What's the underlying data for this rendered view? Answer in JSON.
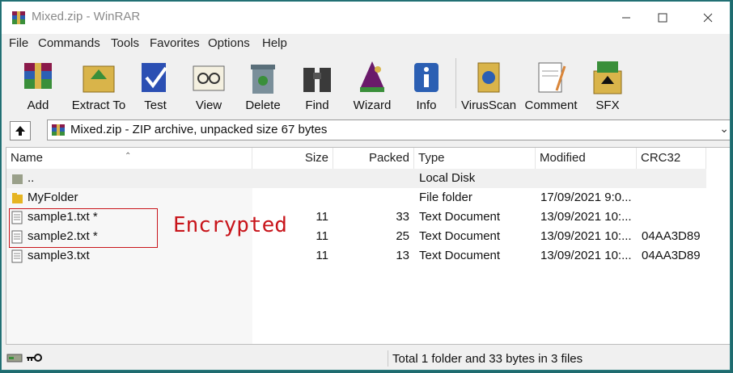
{
  "window": {
    "title": "Mixed.zip - WinRAR"
  },
  "menu": [
    "File",
    "Commands",
    "Tools",
    "Favorites",
    "Options",
    "Help"
  ],
  "toolbar": [
    {
      "label": "Add",
      "icon": "add-icon"
    },
    {
      "label": "Extract To",
      "icon": "extract-to-icon"
    },
    {
      "label": "Test",
      "icon": "test-icon"
    },
    {
      "label": "View",
      "icon": "view-icon"
    },
    {
      "label": "Delete",
      "icon": "delete-icon"
    },
    {
      "label": "Find",
      "icon": "find-icon"
    },
    {
      "label": "Wizard",
      "icon": "wizard-icon"
    },
    {
      "label": "Info",
      "icon": "info-icon"
    },
    {
      "label": "VirusScan",
      "icon": "virusscan-icon"
    },
    {
      "label": "Comment",
      "icon": "comment-icon"
    },
    {
      "label": "SFX",
      "icon": "sfx-icon"
    }
  ],
  "address": {
    "text": "Mixed.zip - ZIP archive, unpacked size 67 bytes"
  },
  "columns": [
    "Name",
    "Size",
    "Packed",
    "Type",
    "Modified",
    "CRC32"
  ],
  "rows": [
    {
      "name": "..",
      "size": "",
      "packed": "",
      "type": "Local Disk",
      "modified": "",
      "crc": "",
      "icon": "parent-folder-icon"
    },
    {
      "name": "MyFolder",
      "size": "",
      "packed": "",
      "type": "File folder",
      "modified": "17/09/2021 9:0...",
      "crc": "",
      "icon": "folder-icon"
    },
    {
      "name": "sample1.txt *",
      "size": "11",
      "packed": "33",
      "type": "Text Document",
      "modified": "13/09/2021 10:...",
      "crc": "",
      "icon": "text-file-icon"
    },
    {
      "name": "sample2.txt *",
      "size": "11",
      "packed": "25",
      "type": "Text Document",
      "modified": "13/09/2021 10:...",
      "crc": "04AA3D89",
      "icon": "text-file-icon"
    },
    {
      "name": "sample3.txt",
      "size": "11",
      "packed": "13",
      "type": "Text Document",
      "modified": "13/09/2021 10:...",
      "crc": "04AA3D89",
      "icon": "text-file-icon"
    }
  ],
  "annotation": {
    "label": "Encrypted",
    "color": "#c8151b"
  },
  "status": {
    "text": "Total 1 folder and 33 bytes in 3 files"
  }
}
